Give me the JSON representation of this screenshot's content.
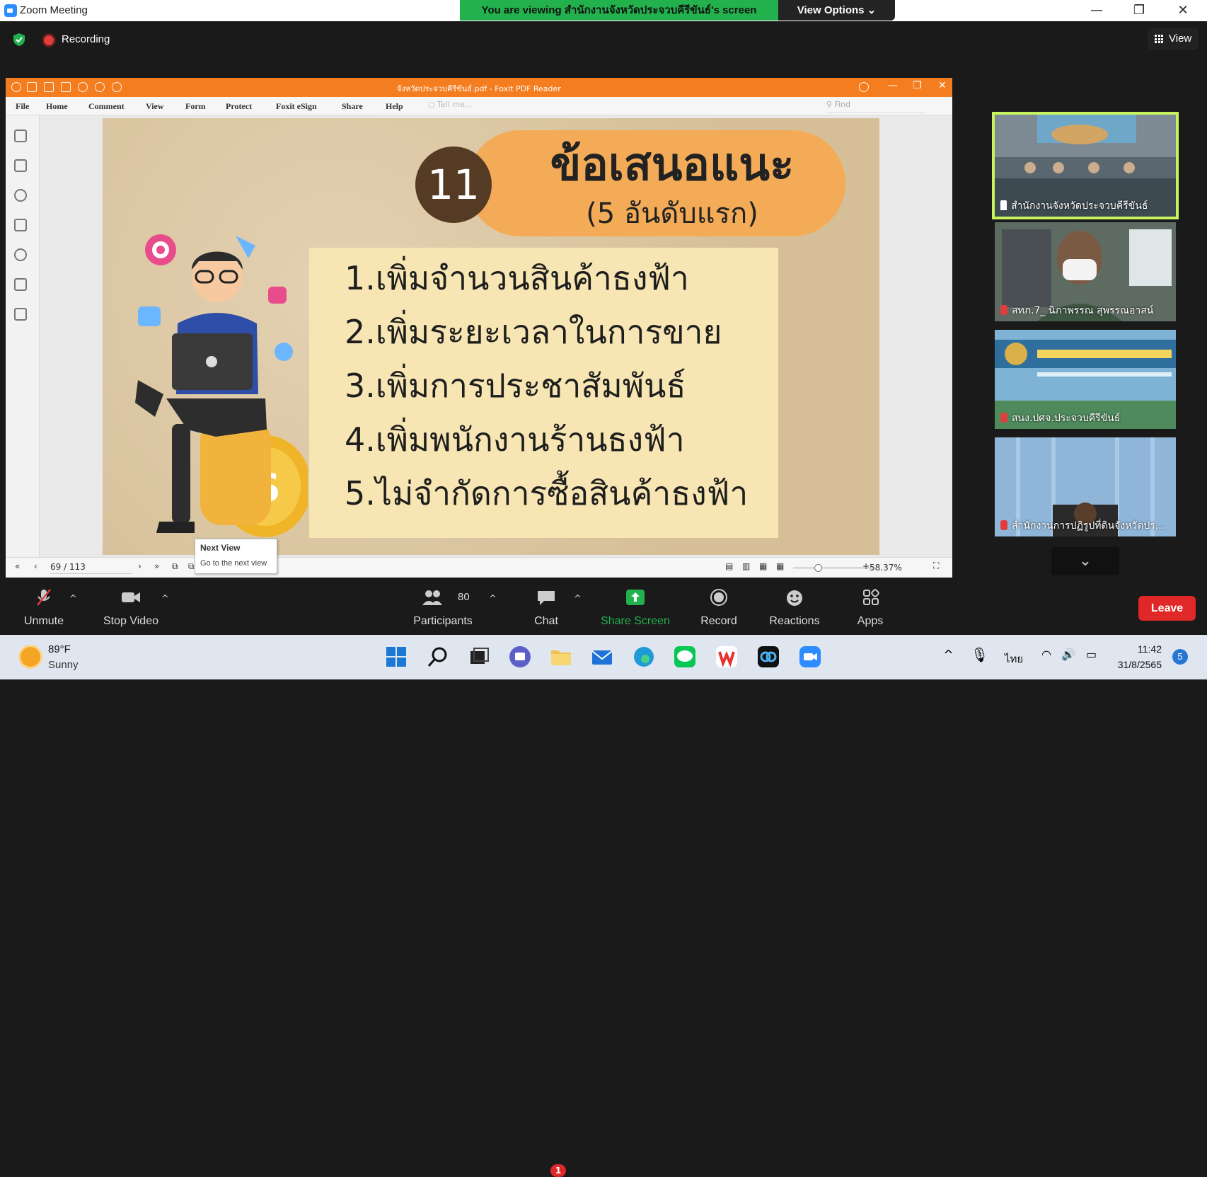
{
  "window": {
    "app_title": "Zoom Meeting",
    "share_banner": "You are viewing สำนักงานจังหวัดประจวบคีรีขันธ์'s screen",
    "view_options_label": "View Options ⌄",
    "minimize_glyph": "—",
    "maximize_glyph": "❐",
    "close_glyph": "✕"
  },
  "meeting": {
    "recording_label": "Recording",
    "view_label": "View"
  },
  "foxit": {
    "doc_title": "จังหวัดประจวบคีรีขันธ์.pdf - Foxit PDF Reader",
    "menu": [
      "File",
      "Home",
      "Comment",
      "View",
      "Form",
      "Protect",
      "Foxit eSign",
      "Share",
      "Help"
    ],
    "tell_me_placeholder": "Tell me...",
    "find_placeholder": "Find",
    "page_indicator": "69 / 113",
    "zoom_level": "58.37%",
    "tooltip_title": "Next View",
    "tooltip_body": "Go to the next view"
  },
  "slide": {
    "badge": "11",
    "title": "ข้อเสนอแนะ",
    "subtitle": "(5 อันดับแรก)",
    "items": [
      "1.เพิ่มจำนวนสินค้าธงฟ้า",
      "2.เพิ่มระยะเวลาในการขาย",
      "3.เพิ่มการประชาสัมพันธ์",
      "4.เพิ่มพนักงานร้านธงฟ้า",
      "5.ไม่จำกัดการซื้อสินค้าธงฟ้า"
    ]
  },
  "participants": [
    {
      "name": "สำนักงานจังหวัดประจวบคีรีขันธ์",
      "pinned": true
    },
    {
      "name": "สทภ.7_ นิภาพรรณ สุพรรณอาสน์",
      "pinned": false
    },
    {
      "name": "สนง.ปศจ.ประจวบคีรีขันธ์",
      "pinned": false
    },
    {
      "name": "สำนักงานการปฏิรูปที่ดินจังหวัดปร...",
      "pinned": false
    }
  ],
  "toolbar": {
    "unmute": "Unmute",
    "stop_video": "Stop Video",
    "participants": "Participants",
    "participant_count": "80",
    "chat": "Chat",
    "chat_badge": "1",
    "share_screen": "Share Screen",
    "record": "Record",
    "reactions": "Reactions",
    "apps": "Apps",
    "leave": "Leave",
    "share_color": "#22b14c",
    "leave_color": "#e02828"
  },
  "taskbar": {
    "temperature": "89°F",
    "condition": "Sunny",
    "language": "ไทย",
    "time": "11:42",
    "date": "31/8/2565",
    "notification_count": "5"
  }
}
